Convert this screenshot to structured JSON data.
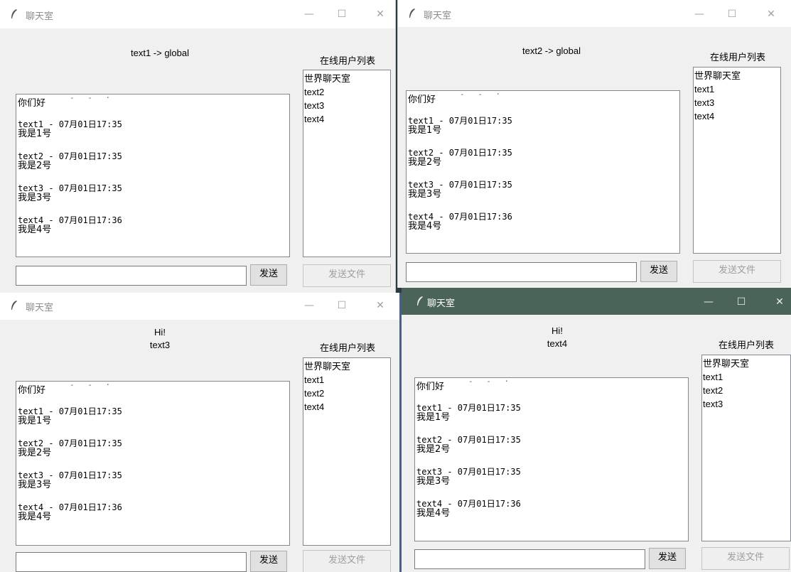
{
  "title": "聊天室",
  "controls": {
    "minimize": "—",
    "maximize": "☐",
    "close": "✕"
  },
  "users_label": "在线用户列表",
  "send_label": "发送",
  "send_file_label": "发送文件",
  "chat": {
    "greeting": "你们好",
    "messages": [
      {
        "head": "text1 - 07月01日17:35",
        "body": "我是1号"
      },
      {
        "head": "text2 - 07月01日17:35",
        "body": "我是2号"
      },
      {
        "head": "text3 - 07月01日17:35",
        "body": "我是3号"
      },
      {
        "head": "text4 - 07月01日17:36",
        "body": "我是4号"
      }
    ]
  },
  "windows": [
    {
      "header": [
        "text1 -> global"
      ],
      "users": [
        "世界聊天室",
        "text2",
        "text3",
        "text4"
      ],
      "active": false
    },
    {
      "header": [
        "text2 -> global"
      ],
      "users": [
        "世界聊天室",
        "text1",
        "text3",
        "text4"
      ],
      "active": false
    },
    {
      "header": [
        "Hi!",
        "text3"
      ],
      "users": [
        "世界聊天室",
        "text1",
        "text2",
        "text4"
      ],
      "active": false
    },
    {
      "header": [
        "Hi!",
        "text4"
      ],
      "users": [
        "世界聊天室",
        "text1",
        "text2",
        "text3"
      ],
      "active": true
    }
  ],
  "colors": {
    "active_titlebar": "#4b6459",
    "window_bg": "#f0f0f0"
  }
}
